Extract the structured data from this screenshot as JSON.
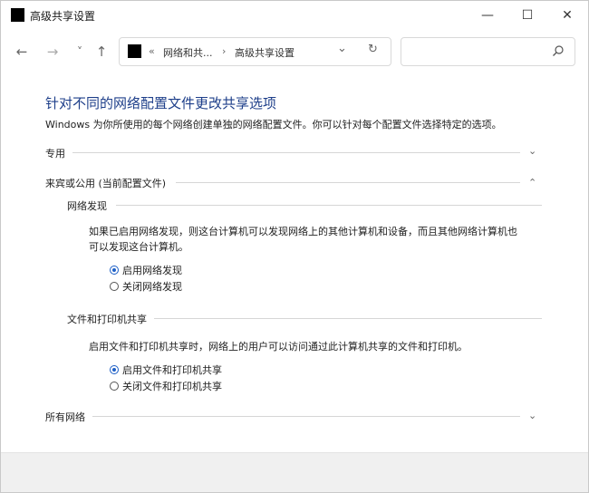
{
  "window": {
    "title": "高级共享设置",
    "minimize_glyph": "—",
    "maximize_glyph": "☐",
    "close_glyph": "✕"
  },
  "nav": {
    "back_glyph": "←",
    "forward_glyph": "→",
    "recent_glyph": "˅",
    "up_glyph": "↑",
    "breadcrumb_overflow": "«",
    "breadcrumb": [
      "网络和共...",
      "高级共享设置"
    ],
    "breadcrumb_sep": "›",
    "dropdown_glyph": "⌄",
    "refresh_glyph": "↻",
    "search_placeholder": ""
  },
  "content": {
    "heading": "针对不同的网络配置文件更改共享选项",
    "description": "Windows 为你所使用的每个网络创建单独的网络配置文件。你可以针对每个配置文件选择特定的选项。",
    "profiles": [
      {
        "label": "专用",
        "expanded": false,
        "chevron": "⌄"
      },
      {
        "label": "来宾或公用 (当前配置文件)",
        "expanded": true,
        "chevron": "⌃"
      },
      {
        "label": "所有网络",
        "expanded": false,
        "chevron": "⌄"
      }
    ],
    "network_discovery": {
      "title": "网络发现",
      "text_line1": "如果已启用网络发现，则这台计算机可以发现网络上的其他计算机和设备，而且其他网络计算机也",
      "text_line2": "可以发现这台计算机。",
      "options": [
        {
          "label": "启用网络发现",
          "selected": true
        },
        {
          "label": "关闭网络发现",
          "selected": false
        }
      ]
    },
    "file_printer_sharing": {
      "title": "文件和打印机共享",
      "text": "启用文件和打印机共享时，网络上的用户可以访问通过此计算机共享的文件和打印机。",
      "options": [
        {
          "label": "启用文件和打印机共享",
          "selected": true
        },
        {
          "label": "关闭文件和打印机共享",
          "selected": false
        }
      ]
    }
  },
  "colors": {
    "heading": "#1e3f8a",
    "radio_accent": "#1d5fc6",
    "footer_bg": "#f0f0f0"
  }
}
